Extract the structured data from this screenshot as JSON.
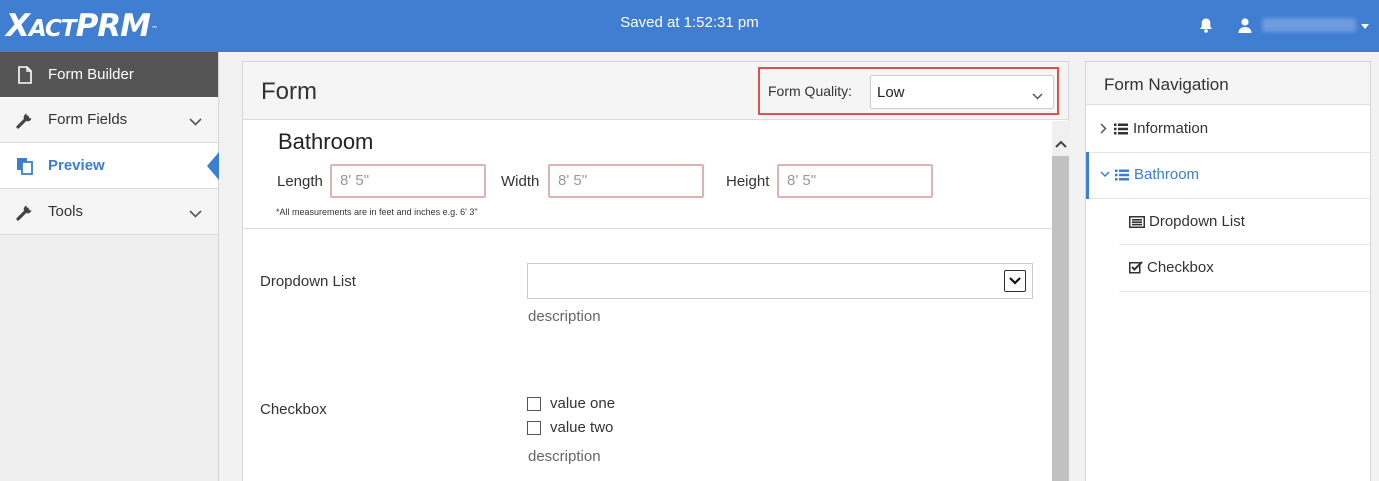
{
  "header": {
    "logo_main": "X",
    "logo_small": "ACT",
    "logo_rest": "PRM",
    "logo_tm": "™",
    "saved_status": "Saved at 1:52:31 pm",
    "icons": [
      "bell-icon",
      "user-icon",
      "caret-down-icon"
    ]
  },
  "sidebar": {
    "items": [
      {
        "label": "Form Builder",
        "icon": "file-icon"
      },
      {
        "label": "Form Fields",
        "icon": "wrench-icon"
      },
      {
        "label": "Preview",
        "icon": "copy-icon"
      },
      {
        "label": "Tools",
        "icon": "wrench-icon"
      }
    ]
  },
  "form": {
    "title": "Form",
    "quality_label": "Form Quality:",
    "quality_value": "Low",
    "section_title": "Bathroom",
    "length_label": "Length",
    "length_placeholder": "8' 5\"",
    "width_label": "Width",
    "width_placeholder": "8' 5\"",
    "height_label": "Height",
    "height_placeholder": "8' 5\"",
    "measure_note": "*All measurements are in feet and inches e.g. 6' 3\"",
    "dropdown_label": "Dropdown List",
    "dropdown_description": "description",
    "checkbox_label": "Checkbox",
    "checkbox_options": [
      "value one",
      "value two"
    ],
    "checkbox_description": "description"
  },
  "navigation": {
    "title": "Form Navigation",
    "items": [
      {
        "label": "Information",
        "icon": "list-icon"
      },
      {
        "label": "Bathroom",
        "icon": "list-icon"
      },
      {
        "label": "Dropdown List",
        "icon": "dropdown-list-icon"
      },
      {
        "label": "Checkbox",
        "icon": "checkbox-icon"
      }
    ]
  },
  "colors": {
    "brand_blue": "#3f7ed1",
    "active_blue": "#3a7fd4",
    "highlight_red": "#d9534f",
    "sidebar_header": "#555555"
  }
}
